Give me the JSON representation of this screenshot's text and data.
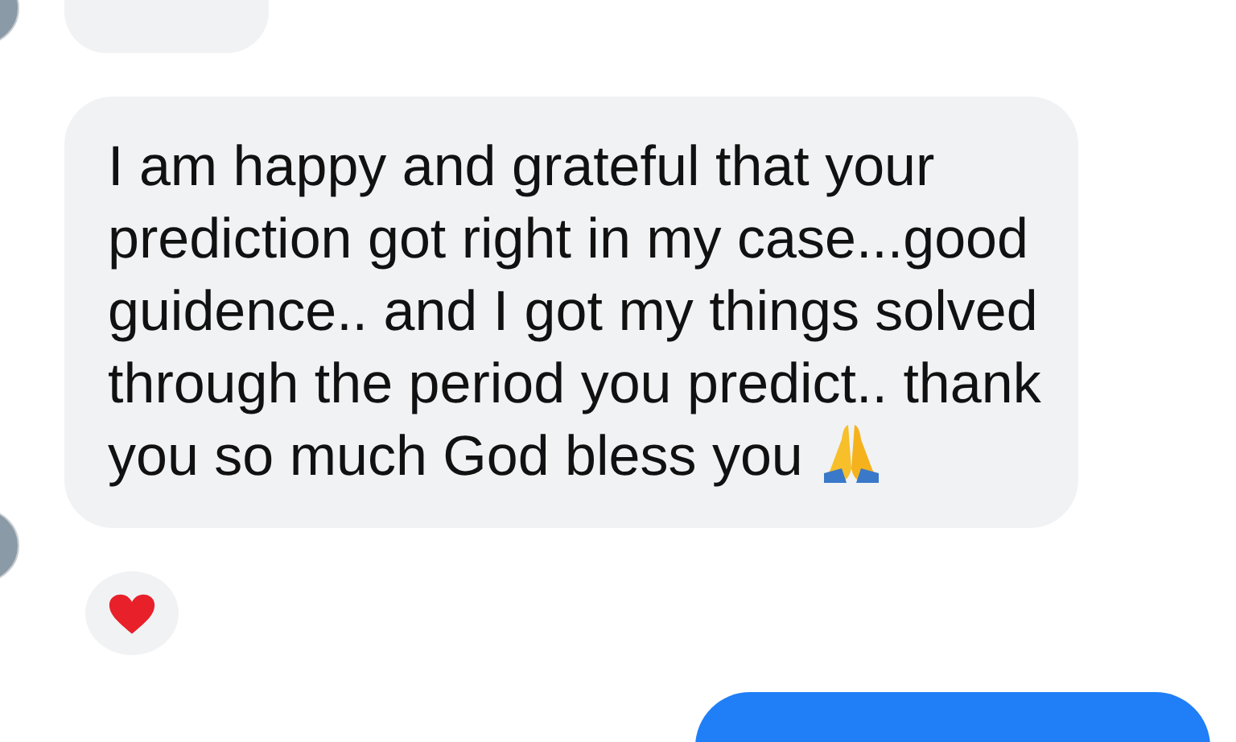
{
  "messages": [
    {
      "kind": "incoming-cut"
    },
    {
      "kind": "incoming",
      "text": "I am happy and grateful that your prediction got right in my case...good guidence.. and I got my things solved through the period you predict.. thank you so much God bless you"
    },
    {
      "kind": "outgoing-cut"
    }
  ]
}
